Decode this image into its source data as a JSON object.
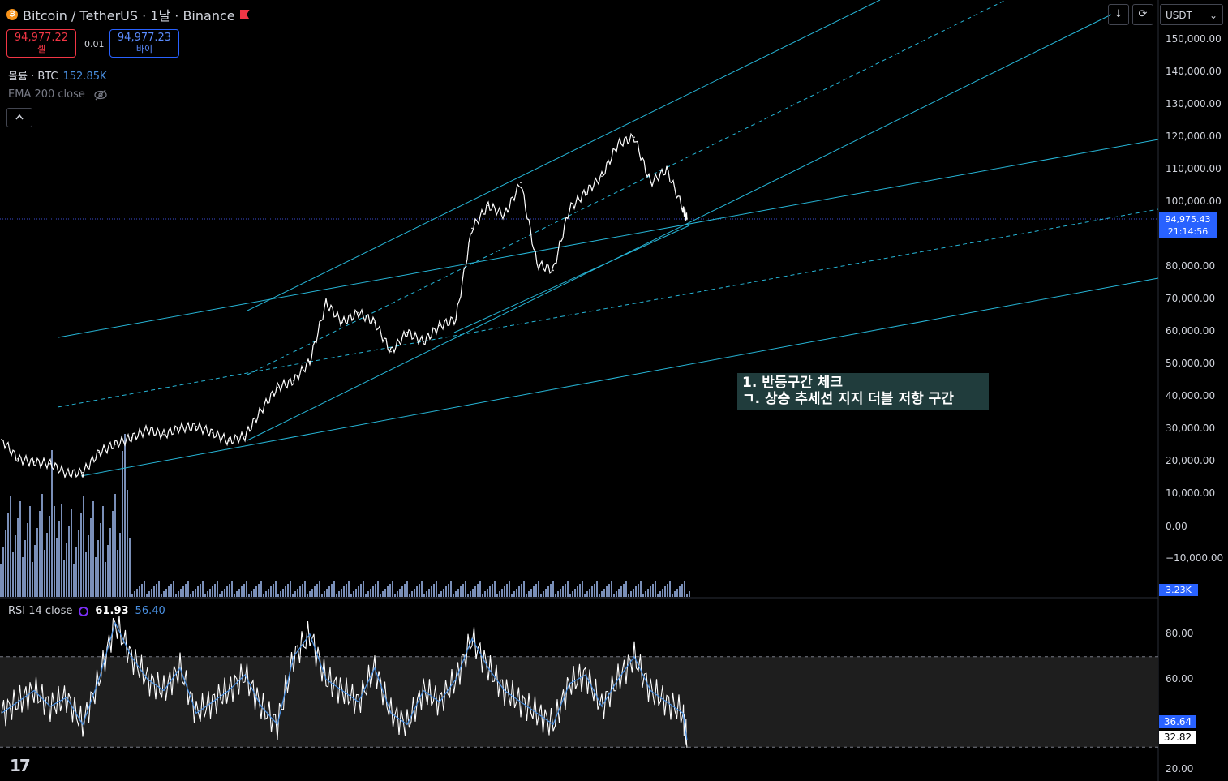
{
  "header": {
    "title": "Bitcoin / TetherUS · 1날 · Binance",
    "coin_icon": "₿"
  },
  "trade": {
    "sell_price": "94,977.22",
    "sell_label": "셀",
    "spread": "0.01",
    "buy_price": "94,977.23",
    "buy_label": "바이"
  },
  "volume_legend": {
    "label": "볼륨 · BTC",
    "value": "152.85K"
  },
  "ema_legend": {
    "label": "EMA 200 close",
    "icon": "eye-off-icon"
  },
  "collapse_icon": "chevron-up-icon",
  "toolbar": {
    "currency": "USDT",
    "currency_chevron": "⌄",
    "download_icon": "↓",
    "refresh_icon": "⟳"
  },
  "price_axis": {
    "ticks": [
      "150,000.00",
      "140,000.00",
      "130,000.00",
      "120,000.00",
      "110,000.00",
      "100,000.00",
      "80,000.00",
      "70,000.00",
      "60,000.00",
      "50,000.00",
      "40,000.00",
      "30,000.00",
      "20,000.00",
      "10,000.00",
      "0.00",
      "−10,000.00",
      ".00"
    ],
    "current_price": "94,975.43",
    "countdown": "21:14:56",
    "volume_tag": "3.23K"
  },
  "rsi": {
    "label": "RSI 14 close",
    "value": "61.93",
    "ma_value": "56.40",
    "ticks": [
      "80.00",
      "60.00",
      "20.00"
    ],
    "tag_ma": "36.64",
    "tag_rsi": "32.82"
  },
  "annotation": {
    "text": "1. 반등구간 체크\nㄱ. 상승 추세선 지지 더블 저항 구간"
  },
  "logo": "17",
  "colors": {
    "background": "#000000",
    "trendline": "#26b5d6",
    "candle": "#ffffff",
    "volume": "#8fa8d8",
    "accent": "#2962ff",
    "rsi_ma": "#4a90e2",
    "rsi_band": "#1e1e1e"
  },
  "chart_data": {
    "type": "line",
    "title": "Bitcoin / TetherUS · 1날 · Binance",
    "xlabel": "",
    "ylabel": "",
    "ylim": [
      -10000,
      150000
    ],
    "grid": false,
    "x": [
      0,
      20,
      40,
      60,
      80,
      100,
      120,
      140,
      160,
      180,
      200,
      220,
      240,
      260,
      280,
      300,
      320,
      340,
      360,
      380,
      400,
      420,
      440,
      460,
      480,
      500,
      520,
      540,
      560,
      580,
      600,
      620,
      640,
      660,
      680,
      700,
      720,
      740,
      760,
      780,
      800,
      820,
      840,
      845
    ],
    "series": [
      {
        "name": "",
        "values": [
          27000,
          21000,
          20000,
          19500,
          16500,
          16800,
          23000,
          25500,
          27500,
          30000,
          28500,
          30500,
          31000,
          29000,
          26500,
          28000,
          36000,
          43000,
          45000,
          51000,
          69000,
          63000,
          66000,
          63000,
          54000,
          60000,
          57000,
          62000,
          64000,
          92000,
          99000,
          96000,
          106000,
          81000,
          79000,
          98000,
          103000,
          108000,
          118000,
          120000,
          106000,
          110000,
          98000,
          94975
        ]
      }
    ],
    "rsi_values": [
      45,
      50,
      55,
      48,
      52,
      40,
      60,
      85,
      70,
      60,
      55,
      65,
      45,
      50,
      55,
      62,
      48,
      40,
      70,
      80,
      60,
      55,
      50,
      65,
      45,
      40,
      55,
      50,
      60,
      78,
      65,
      55,
      50,
      45,
      40,
      58,
      62,
      48,
      60,
      70,
      55,
      50,
      45,
      33
    ],
    "rsi_bands": [
      30,
      50,
      70
    ]
  }
}
